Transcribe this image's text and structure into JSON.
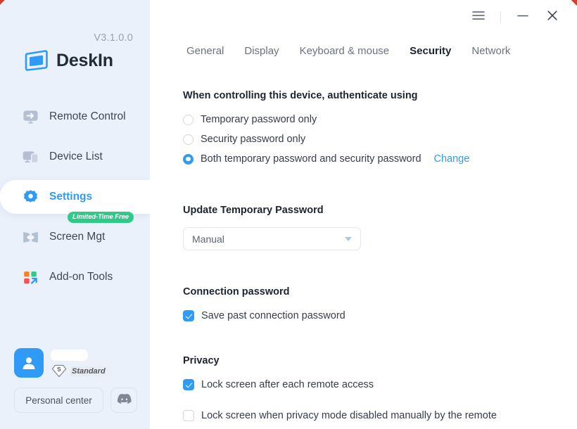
{
  "brand": {
    "version": "V3.1.0.0",
    "name": "DeskIn",
    "logo_icon": "deskin-logo-icon",
    "logo_color": "#2f9bf6",
    "name_color": "#222b3a"
  },
  "window_controls": {
    "menu_icon": "hamburger-menu-icon",
    "minimize_icon": "minimize-icon",
    "close_icon": "close-icon"
  },
  "sidebar": {
    "background": "#eaf1fa",
    "active_color": "#2f9bf6",
    "items": [
      {
        "label": "Remote Control",
        "icon": "monitor-arrow-icon",
        "active": false,
        "badge": null
      },
      {
        "label": "Device List",
        "icon": "devices-icon",
        "active": false,
        "badge": null
      },
      {
        "label": "Settings",
        "icon": "gear-icon",
        "active": true,
        "badge": null
      },
      {
        "label": "Screen Mgt",
        "icon": "screen-split-icon",
        "active": false,
        "badge": "Limited-Time Free"
      },
      {
        "label": "Add-on Tools",
        "icon": "addon-grid-icon",
        "active": false,
        "badge": null
      }
    ],
    "badge_color": "#2fc98a",
    "account": {
      "avatar_icon": "user-avatar-icon",
      "username_redacted": true,
      "tier_badge_icon": "standard-diamond-icon",
      "tier_badge_letter": "S",
      "tier_label": "Standard"
    },
    "footer": {
      "personal_center_label": "Personal center",
      "discord_icon": "discord-icon"
    }
  },
  "tabs": [
    {
      "label": "General",
      "active": false
    },
    {
      "label": "Display",
      "active": false
    },
    {
      "label": "Keyboard & mouse",
      "active": false
    },
    {
      "label": "Security",
      "active": true
    },
    {
      "label": "Network",
      "active": false
    }
  ],
  "sections": {
    "authenticate": {
      "title": "When controlling this device, authenticate using",
      "options": [
        {
          "label": "Temporary password only",
          "selected": false
        },
        {
          "label": "Security password only",
          "selected": false
        },
        {
          "label": "Both temporary password and security password",
          "selected": true,
          "link": "Change"
        }
      ]
    },
    "update_temp_password": {
      "title": "Update Temporary Password",
      "select_value": "Manual",
      "caret_icon": "chevron-down-icon"
    },
    "connection_password": {
      "title": "Connection password",
      "checkboxes": [
        {
          "label": "Save past connection password",
          "checked": true
        }
      ]
    },
    "privacy": {
      "title": "Privacy",
      "checkboxes": [
        {
          "label": "Lock screen after each remote access",
          "checked": true
        },
        {
          "label": "Lock screen when privacy mode disabled manually by the remote",
          "checked": false
        }
      ]
    }
  }
}
